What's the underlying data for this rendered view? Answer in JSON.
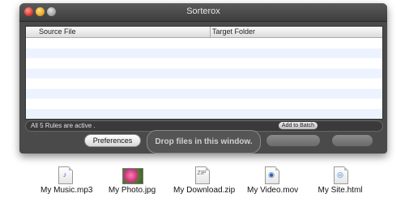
{
  "window": {
    "title": "Sorterox"
  },
  "table": {
    "columns": [
      "Source File",
      "Target Folder"
    ],
    "rows": []
  },
  "status": {
    "text": "All 5 Rules are active .",
    "add_batch_label": "Add to Batch"
  },
  "buttons": {
    "preferences": "Preferences",
    "drop_zone": "Drop files in this window."
  },
  "files": [
    {
      "label": "My Music.mp3",
      "icon": "mp3-file-icon"
    },
    {
      "label": "My Photo.jpg",
      "icon": "photo-file-icon"
    },
    {
      "label": "My Download.zip",
      "icon": "zip-file-icon"
    },
    {
      "label": "My Video.mov",
      "icon": "movie-file-icon"
    },
    {
      "label": "My Site.html",
      "icon": "html-file-icon"
    }
  ]
}
